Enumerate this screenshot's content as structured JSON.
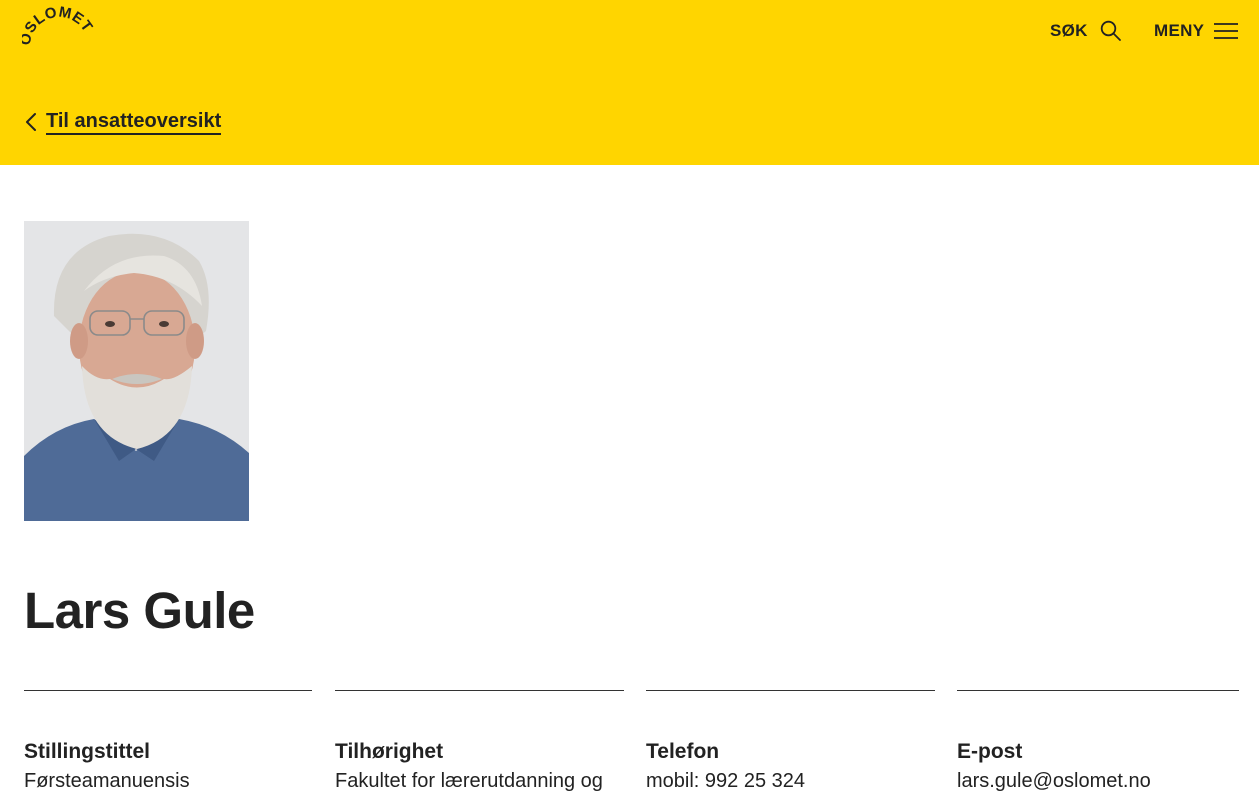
{
  "header": {
    "logo_text": "OSLOMET",
    "search_label": "SØK",
    "menu_label": "MENY",
    "back_link": "Til ansatteoversikt"
  },
  "profile": {
    "name": "Lars Gule"
  },
  "info": [
    {
      "label": "Stillingstittel",
      "value": "Førsteamanuensis"
    },
    {
      "label": "Tilhørighet",
      "value": "Fakultet for lærerutdanning og"
    },
    {
      "label": "Telefon",
      "value": "mobil: 992 25 324"
    },
    {
      "label": "E-post",
      "value": "lars.gule@oslomet.no"
    }
  ],
  "colors": {
    "brand_yellow": "#ffd500",
    "text": "#222222"
  }
}
